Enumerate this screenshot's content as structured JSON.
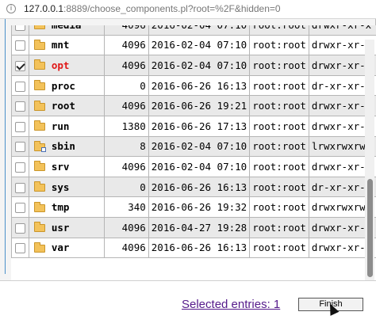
{
  "address_bar": {
    "url_host": "127.0.0.1",
    "url_rest": ":8889/choose_components.pl?root=%2F&hidden=0"
  },
  "rows": [
    {
      "checked": false,
      "name": "media",
      "size": "4096",
      "date": "2016-02-04 07:10",
      "owner": "root:root",
      "perm": "drwxr-xr-x",
      "link": false,
      "highlight": false
    },
    {
      "checked": false,
      "name": "mnt",
      "size": "4096",
      "date": "2016-02-04 07:10",
      "owner": "root:root",
      "perm": "drwxr-xr-x",
      "link": false,
      "highlight": false
    },
    {
      "checked": true,
      "name": "opt",
      "size": "4096",
      "date": "2016-02-04 07:10",
      "owner": "root:root",
      "perm": "drwxr-xr-x",
      "link": false,
      "highlight": true
    },
    {
      "checked": false,
      "name": "proc",
      "size": "0",
      "date": "2016-06-26 16:13",
      "owner": "root:root",
      "perm": "dr-xr-xr-x",
      "link": false,
      "highlight": false
    },
    {
      "checked": false,
      "name": "root",
      "size": "4096",
      "date": "2016-06-26 19:21",
      "owner": "root:root",
      "perm": "drwxr-xr-x",
      "link": false,
      "highlight": false
    },
    {
      "checked": false,
      "name": "run",
      "size": "1380",
      "date": "2016-06-26 17:13",
      "owner": "root:root",
      "perm": "drwxr-xr-x",
      "link": false,
      "highlight": false
    },
    {
      "checked": false,
      "name": "sbin",
      "size": "8",
      "date": "2016-02-04 07:10",
      "owner": "root:root",
      "perm": "lrwxrwxrwx",
      "link": true,
      "highlight": false
    },
    {
      "checked": false,
      "name": "srv",
      "size": "4096",
      "date": "2016-02-04 07:10",
      "owner": "root:root",
      "perm": "drwxr-xr-x",
      "link": false,
      "highlight": false
    },
    {
      "checked": false,
      "name": "sys",
      "size": "0",
      "date": "2016-06-26 16:13",
      "owner": "root:root",
      "perm": "dr-xr-xr-x",
      "link": false,
      "highlight": false
    },
    {
      "checked": false,
      "name": "tmp",
      "size": "340",
      "date": "2016-06-26 19:32",
      "owner": "root:root",
      "perm": "drwxrwxrwt",
      "link": false,
      "highlight": false
    },
    {
      "checked": false,
      "name": "usr",
      "size": "4096",
      "date": "2016-04-27 19:28",
      "owner": "root:root",
      "perm": "drwxr-xr-x",
      "link": false,
      "highlight": false
    },
    {
      "checked": false,
      "name": "var",
      "size": "4096",
      "date": "2016-06-26 16:13",
      "owner": "root:root",
      "perm": "drwxr-xr-x",
      "link": false,
      "highlight": false
    }
  ],
  "footer": {
    "selected_label": "Selected entries: 1",
    "finish_label": "Finish"
  },
  "colors": {
    "highlight_name": "#e01818",
    "link": "#551a8b",
    "folder": "#f3c25a"
  },
  "icons": {
    "folder": "folder-icon",
    "symlink_folder": "symlink-folder-icon",
    "site_info": "info-icon"
  }
}
